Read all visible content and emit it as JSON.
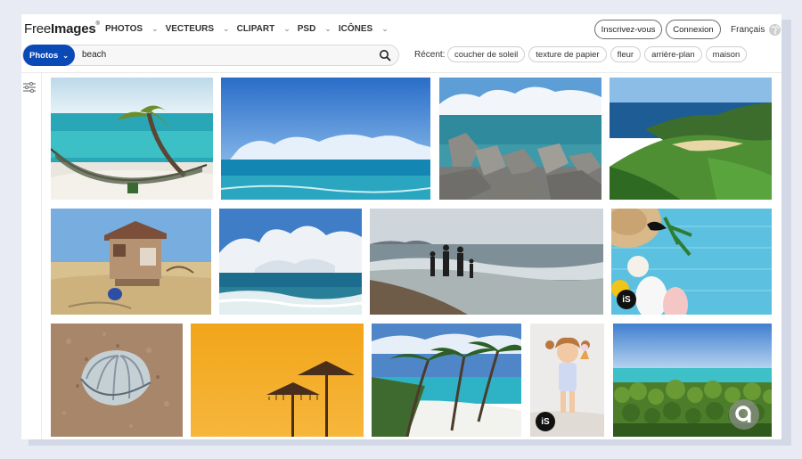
{
  "header": {
    "logo_bold": "Free",
    "logo_rest": "Images",
    "logo_tm": "®",
    "nav": [
      {
        "label": "PHOTOS"
      },
      {
        "label": "VECTEURS"
      },
      {
        "label": "CLIPART"
      },
      {
        "label": "PSD"
      },
      {
        "label": "ICÔNES"
      }
    ],
    "signup_label": "Inscrivez-vous",
    "login_label": "Connexion",
    "language": "Français",
    "globe_icon": "globe-icon"
  },
  "search": {
    "type_label": "Photos",
    "query": "beach",
    "recent_label": "Récent:",
    "recent": [
      "coucher de soleil",
      "texture de papier",
      "fleur",
      "arrière-plan",
      "maison"
    ]
  },
  "results": {
    "badge_text": "iS",
    "photos": [
      {
        "subject": "hammock under palm on tropical beach"
      },
      {
        "subject": "blue sea horizon with clouds"
      },
      {
        "subject": "concrete breakwater blocks by sea"
      },
      {
        "subject": "green cliffs and sandy cove"
      },
      {
        "subject": "beach hut with blue barrel"
      },
      {
        "subject": "waves and cumulus clouds"
      },
      {
        "subject": "family walking on surf line"
      },
      {
        "subject": "straw hat, sunglasses and flip-flops on blue planks",
        "istock": true
      },
      {
        "subject": "seashell in sand"
      },
      {
        "subject": "straw umbrellas silhouettes at orange sunset"
      },
      {
        "subject": "palm trees on white sand beach"
      },
      {
        "subject": "little girl with ice cream on beach",
        "istock": true
      },
      {
        "subject": "palm forest by turquoise sea"
      }
    ]
  },
  "colors": {
    "accent": "#0b49b7",
    "background": "#e8ebf3"
  }
}
